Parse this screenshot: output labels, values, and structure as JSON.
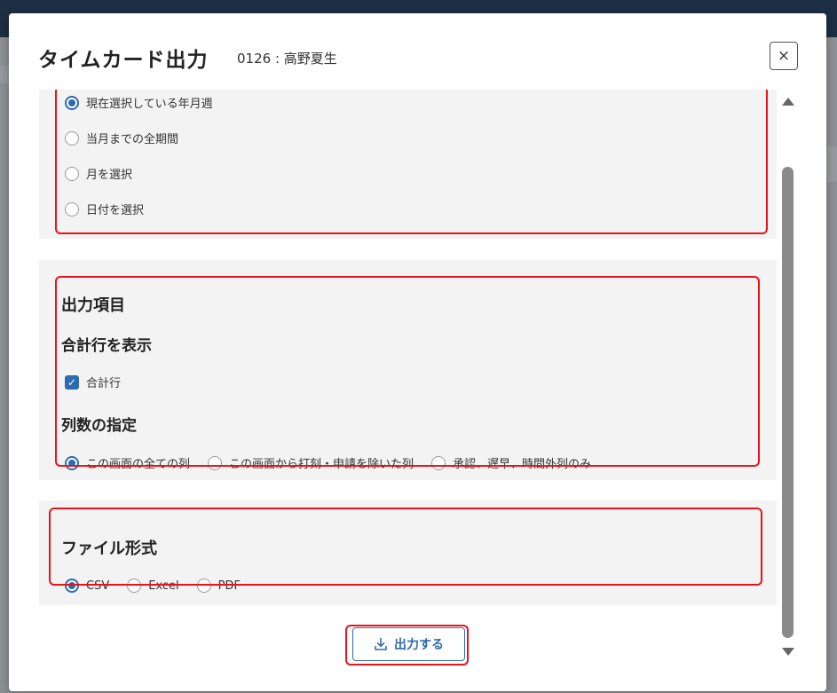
{
  "modal": {
    "title": "タイムカード出力",
    "subtitle": "0126 : 高野夏生",
    "close_symbol": "×"
  },
  "period_section": {
    "options": [
      {
        "label": "現在選択している年月週",
        "checked": true
      },
      {
        "label": "当月までの全期間",
        "checked": false
      },
      {
        "label": "月を選択",
        "checked": false
      },
      {
        "label": "日付を選択",
        "checked": false
      }
    ]
  },
  "output_items": {
    "heading": "出力項目",
    "total_row_heading": "合計行を表示",
    "total_row_checkbox": {
      "label": "合計行",
      "checked": true
    },
    "columns_heading": "列数の指定",
    "column_options": [
      {
        "label": "この画面の全ての列",
        "checked": true
      },
      {
        "label": "この画面から打刻・申請を除いた列",
        "checked": false
      },
      {
        "label": "承認、遅早、時間外列のみ",
        "checked": false
      }
    ]
  },
  "file_format": {
    "heading": "ファイル形式",
    "options": [
      {
        "label": "CSV",
        "checked": true
      },
      {
        "label": "Excel",
        "checked": false
      },
      {
        "label": "PDF",
        "checked": false
      }
    ]
  },
  "footer": {
    "output_button_label": "出力する"
  },
  "icons": {
    "close": "close-icon",
    "download": "download-icon",
    "scroll_up": "triangle-up-icon",
    "scroll_down": "triangle-down-icon"
  },
  "colors": {
    "accent": "#2d6bb0",
    "highlight_border": "#e8141c",
    "section_bg": "#f3f3f3",
    "topbar": "#1d2f45"
  }
}
